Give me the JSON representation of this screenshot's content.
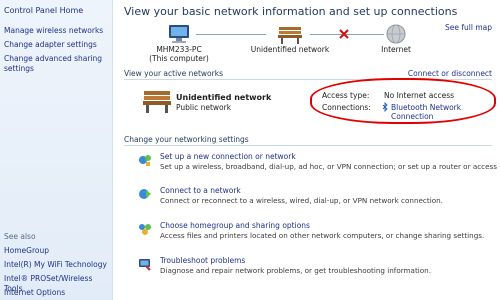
{
  "sidebar": {
    "home": "Control Panel Home",
    "links": [
      "Manage wireless networks",
      "Change adapter settings",
      "Change advanced sharing settings"
    ],
    "see_also_title": "See also",
    "see_also": [
      "HomeGroup",
      "Intel(R) My WiFi Technology",
      "Intel® PROSet/Wireless Tools",
      "Internet Options"
    ]
  },
  "main": {
    "title": "View your basic network information and set up connections",
    "see_full_map": "See full map",
    "map": {
      "computer_name": "MHM233-PC",
      "computer_sub": "(This computer)",
      "network": "Unidentified network",
      "internet": "Internet"
    },
    "active_networks_header": "View your active networks",
    "connect_or_disconnect": "Connect or disconnect",
    "active_network": {
      "name": "Unidentified network",
      "type": "Public network",
      "access_type_label": "Access type:",
      "access_type_value": "No Internet access",
      "connections_label": "Connections:",
      "connections_value": "Bluetooth Network Connection"
    },
    "change_settings_header": "Change your networking settings",
    "tasks": [
      {
        "link": "Set up a new connection or network",
        "desc": "Set up a wireless, broadband, dial-up, ad hoc, or VPN connection; or set up a router or access point.",
        "icon": "new-connection-icon"
      },
      {
        "link": "Connect to a network",
        "desc": "Connect or reconnect to a wireless, wired, dial-up, or VPN network connection.",
        "icon": "connect-network-icon"
      },
      {
        "link": "Choose homegroup and sharing options",
        "desc": "Access files and printers located on other network computers, or change sharing settings.",
        "icon": "homegroup-icon"
      },
      {
        "link": "Troubleshoot problems",
        "desc": "Diagnose and repair network problems, or get troubleshooting information.",
        "icon": "troubleshoot-icon"
      }
    ]
  },
  "colors": {
    "link": "#1e3287",
    "highlight_ellipse": "#e30000",
    "title": "#1e395b"
  }
}
